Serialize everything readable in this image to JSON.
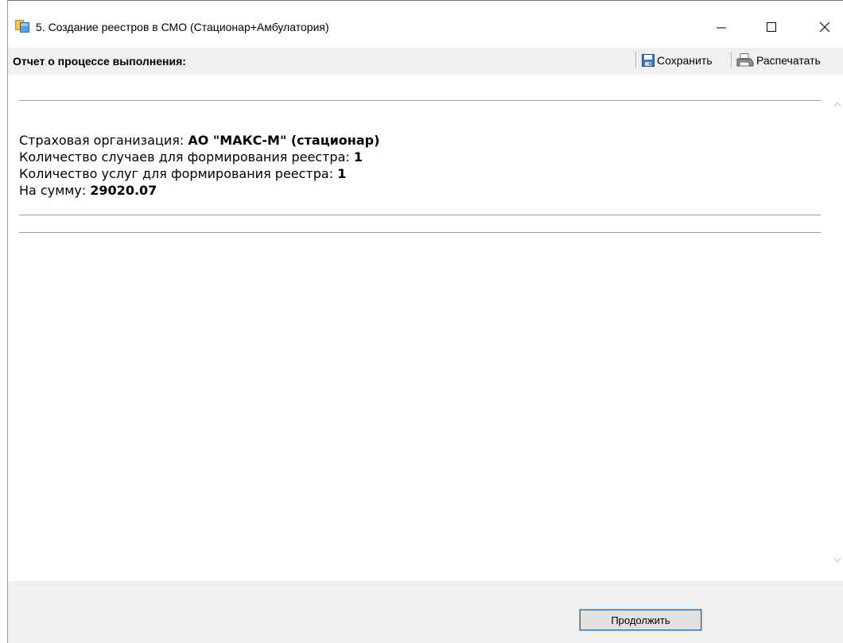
{
  "window": {
    "title": "5. Создание реестров в СМО  (Стационар+Амбулатория)"
  },
  "toolbar": {
    "label": "Отчет о процессе выполнения:",
    "save_label": "Сохранить",
    "print_label": "Распечатать"
  },
  "report": {
    "org_label": "Страховая организация: ",
    "org_value": "АО \"МАКС-М\" (стационар)",
    "cases_label": "Количество случаев для формирования реестра: ",
    "cases_value": "1",
    "services_label": "Количество услуг для формирования реестра: ",
    "services_value": "1",
    "sum_label": "На сумму: ",
    "sum_value": "29020.07"
  },
  "footer": {
    "continue_label": "Продолжить"
  },
  "icons": {
    "app": "app-window-icon",
    "minimize": "minimize-icon",
    "maximize": "maximize-icon",
    "close": "close-icon",
    "save": "floppy-disk-icon",
    "print": "printer-icon"
  },
  "colors": {
    "toolbar_bg": "#f0f0f0",
    "button_focus": "#0078d7"
  }
}
